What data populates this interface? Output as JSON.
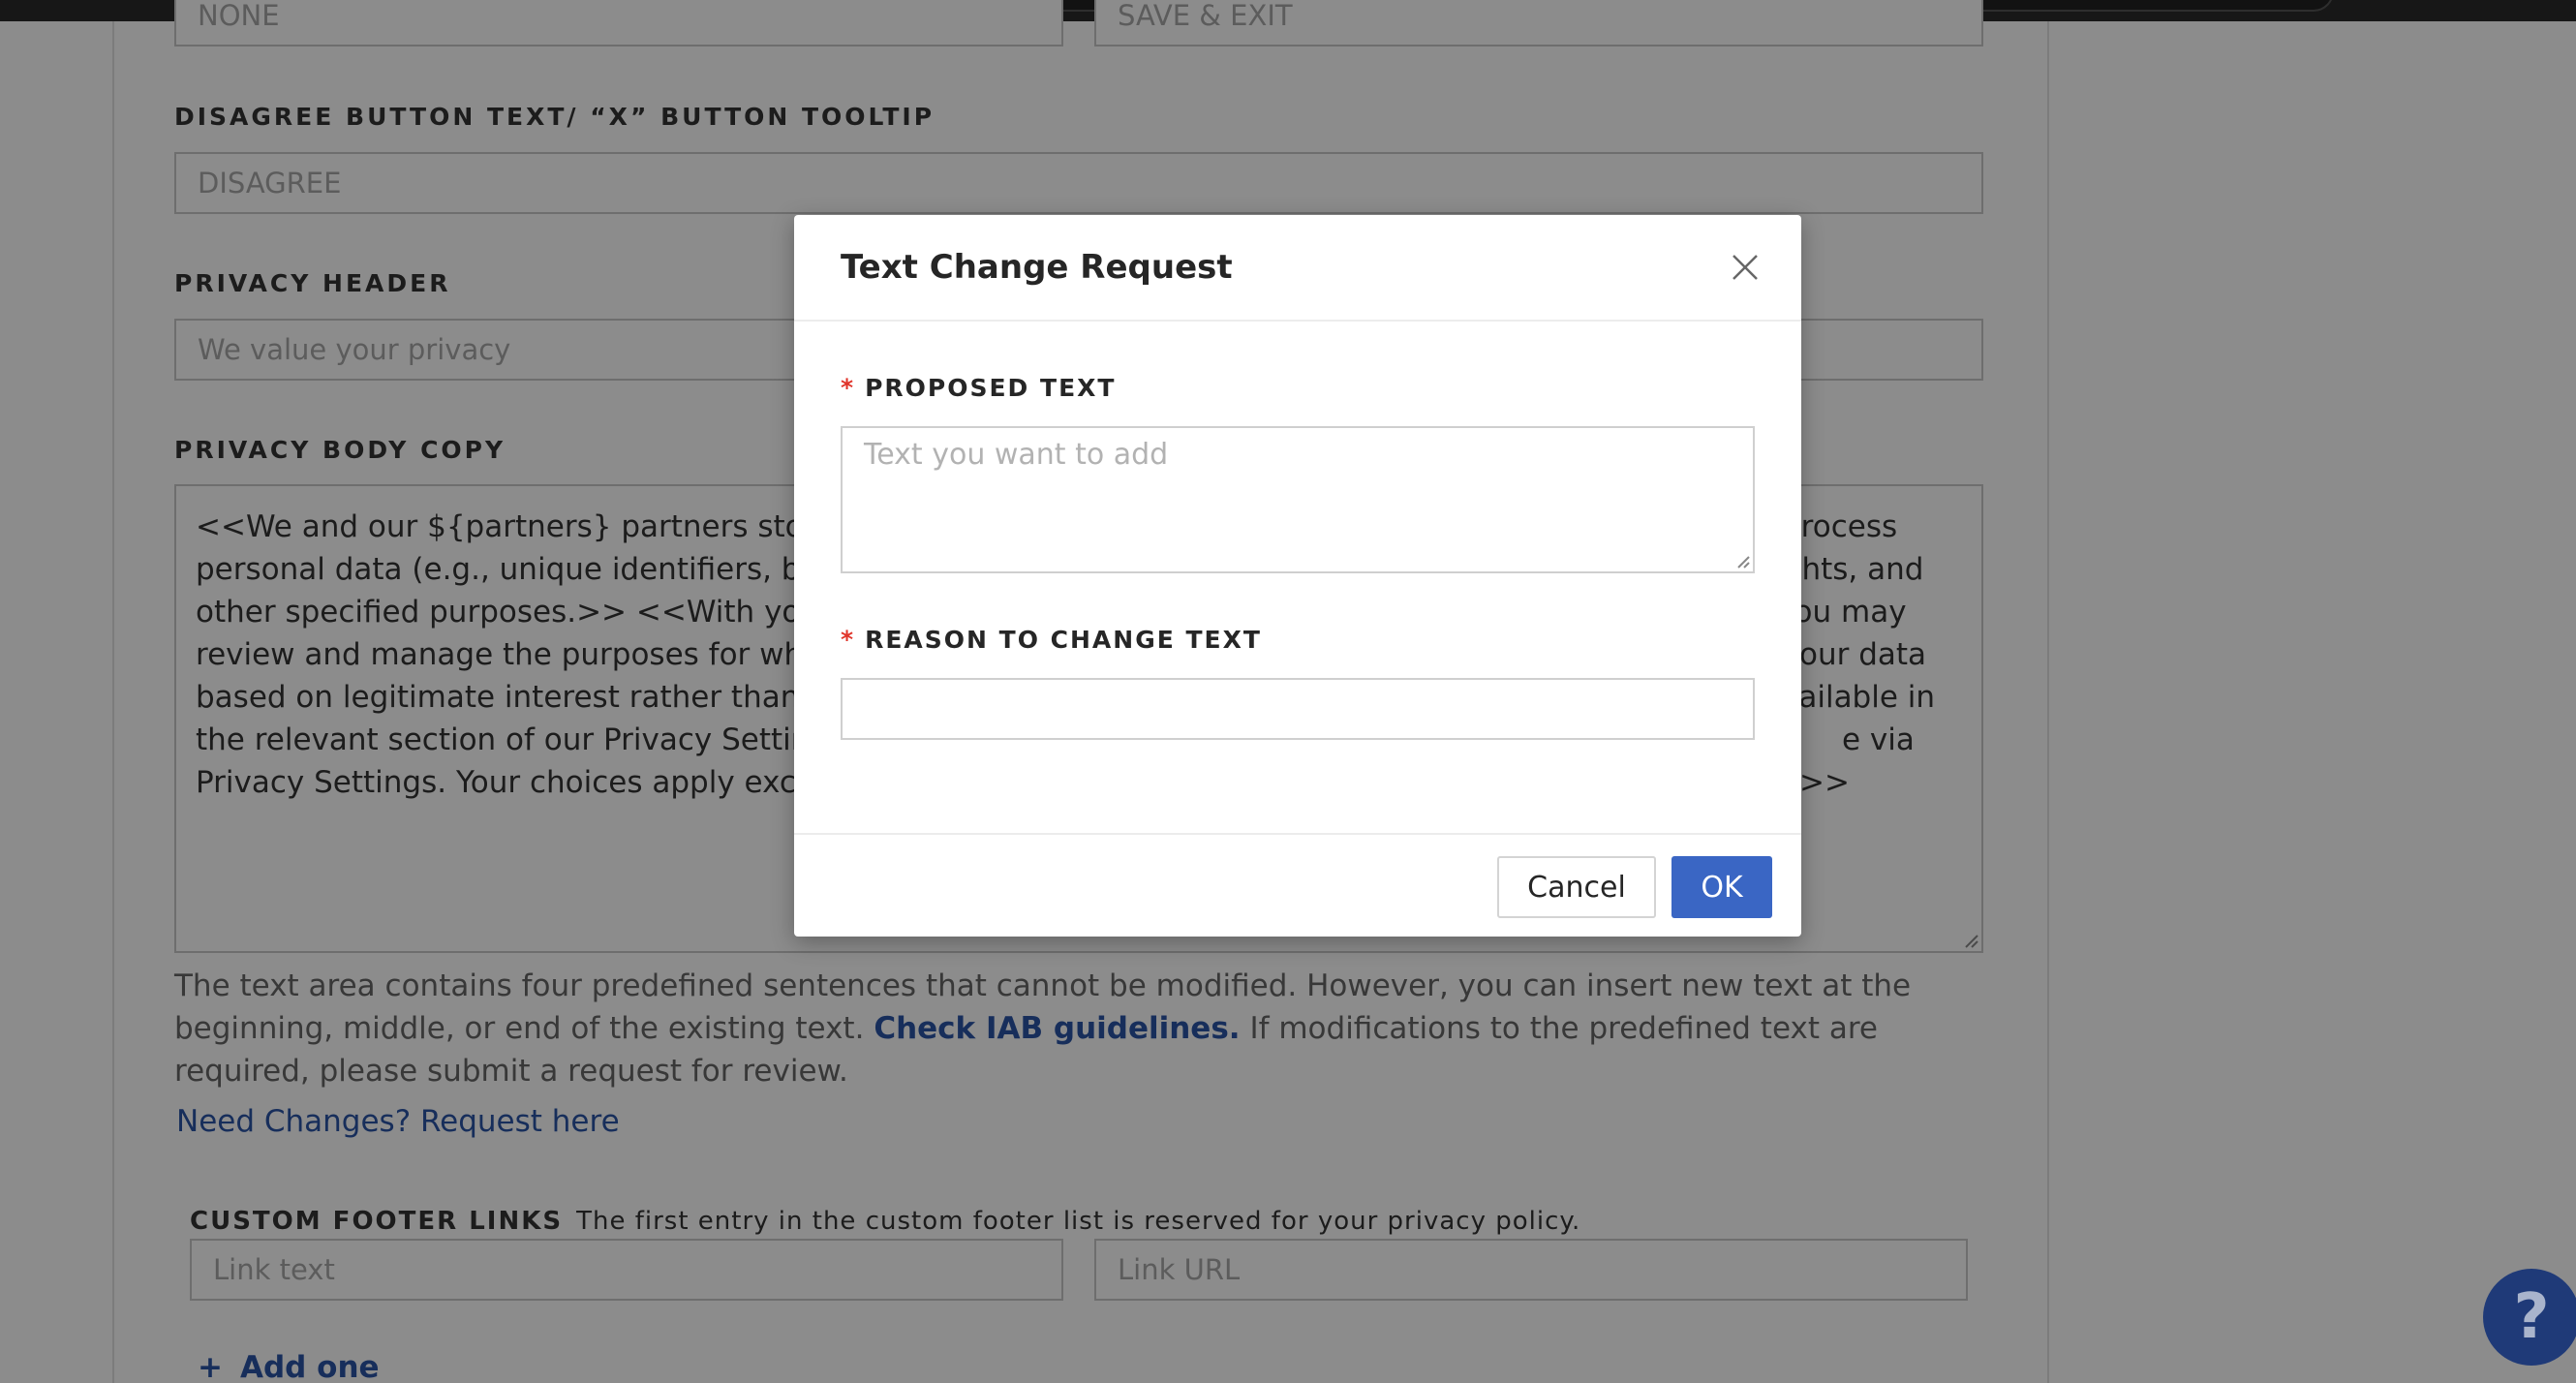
{
  "form": {
    "top_input_left_value": "NONE",
    "top_input_right_value": "SAVE & EXIT",
    "disagree_label": "DISAGREE BUTTON TEXT/ “X” BUTTON TOOLTIP",
    "disagree_placeholder": "DISAGREE",
    "privacy_header_label": "PRIVACY HEADER",
    "privacy_header_placeholder": "We value your privacy",
    "privacy_body_label": "PRIVACY BODY COPY",
    "privacy_body_lines": [
      "<<We and our ${partners} partners store and",
      "process",
      "personal data (e.g., unique identifiers, brows",
      "sights, and",
      "other specified purposes.>> <<With your cons",
      ". You may",
      "review and manage the purposes for which",
      "our data",
      "based on legitimate interest rather than con",
      "available in",
      "the relevant section of our Privacy Settings.>",
      "e via",
      "Privacy Settings. Your choices apply exclusiv",
      ">>"
    ],
    "help_text_1": "The text area contains four predefined sentences that cannot be modified. However, you can insert new text at the beginning, middle, or end of the existing text.",
    "help_text_link": "Check IAB guidelines.",
    "help_text_2": "If modifications to the predefined text are required, please submit a request for review.",
    "need_changes_link": "Need Changes? Request here",
    "custom_footer_label": "CUSTOM FOOTER LINKS",
    "custom_footer_desc": "The first entry in the custom footer list is reserved for your privacy policy.",
    "link_text_placeholder": "Link text",
    "link_url_placeholder": "Link URL",
    "add_one_label": "Add one",
    "add_one_icon": "plus-icon"
  },
  "modal": {
    "title": "Text Change Request",
    "close_icon": "close-icon",
    "proposed_label": "PROPOSED TEXT",
    "proposed_placeholder": "Text you want to add",
    "reason_label": "REASON TO CHANGE TEXT",
    "reason_value": "",
    "required_marker": "*",
    "cancel_label": "Cancel",
    "ok_label": "OK"
  },
  "help_fab": {
    "label": "?",
    "icon": "help-question-icon"
  },
  "colors": {
    "accent": "#3a66c4",
    "link": "#2a55a7",
    "required": "#e0342a",
    "fab": "#1f3a78"
  }
}
